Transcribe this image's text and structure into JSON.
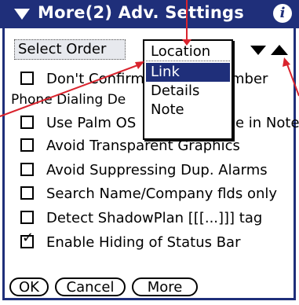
{
  "window": {
    "title": "More(2) Adv. Settings",
    "menu_icon": "triangle-down-icon",
    "info_icon": "info-icon",
    "info_glyph": "i"
  },
  "colors": {
    "titlebar": "#1f2f7a",
    "selection": "#1f2f7a",
    "annotation": "#d9232d"
  },
  "select_order": {
    "label": "Select Order"
  },
  "popup": {
    "items": [
      {
        "label": "Location",
        "selected": false
      },
      {
        "label": "Link",
        "selected": true
      },
      {
        "label": "Details",
        "selected": false
      },
      {
        "label": "Note",
        "selected": false
      }
    ]
  },
  "order_arrows": {
    "down_icon": "arrow-down-icon",
    "up_icon": "arrow-up-icon"
  },
  "options": [
    {
      "label": "Don't Confirm Phone Number",
      "checked": false,
      "visible_prefix": "Don't Confirm",
      "visible_suffix": "mber"
    },
    {
      "label": "Use Palm OS Copy/Paste in Notes",
      "checked": false,
      "visible_suffix": "e in Notes"
    },
    {
      "label": "Avoid Transparent Graphics",
      "checked": false
    },
    {
      "label": "Avoid Suppressing Dup. Alarms",
      "checked": false
    },
    {
      "label": "Search Name/Company flds only",
      "checked": false
    },
    {
      "label": "Detect ShadowPlan [[[...]]] tag",
      "checked": false
    },
    {
      "label": "Enable Hiding of Status Bar",
      "checked": true
    }
  ],
  "phone_dialing_label": "Phone Dialing De",
  "buttons": {
    "ok": "OK",
    "cancel": "Cancel",
    "more": "More"
  }
}
